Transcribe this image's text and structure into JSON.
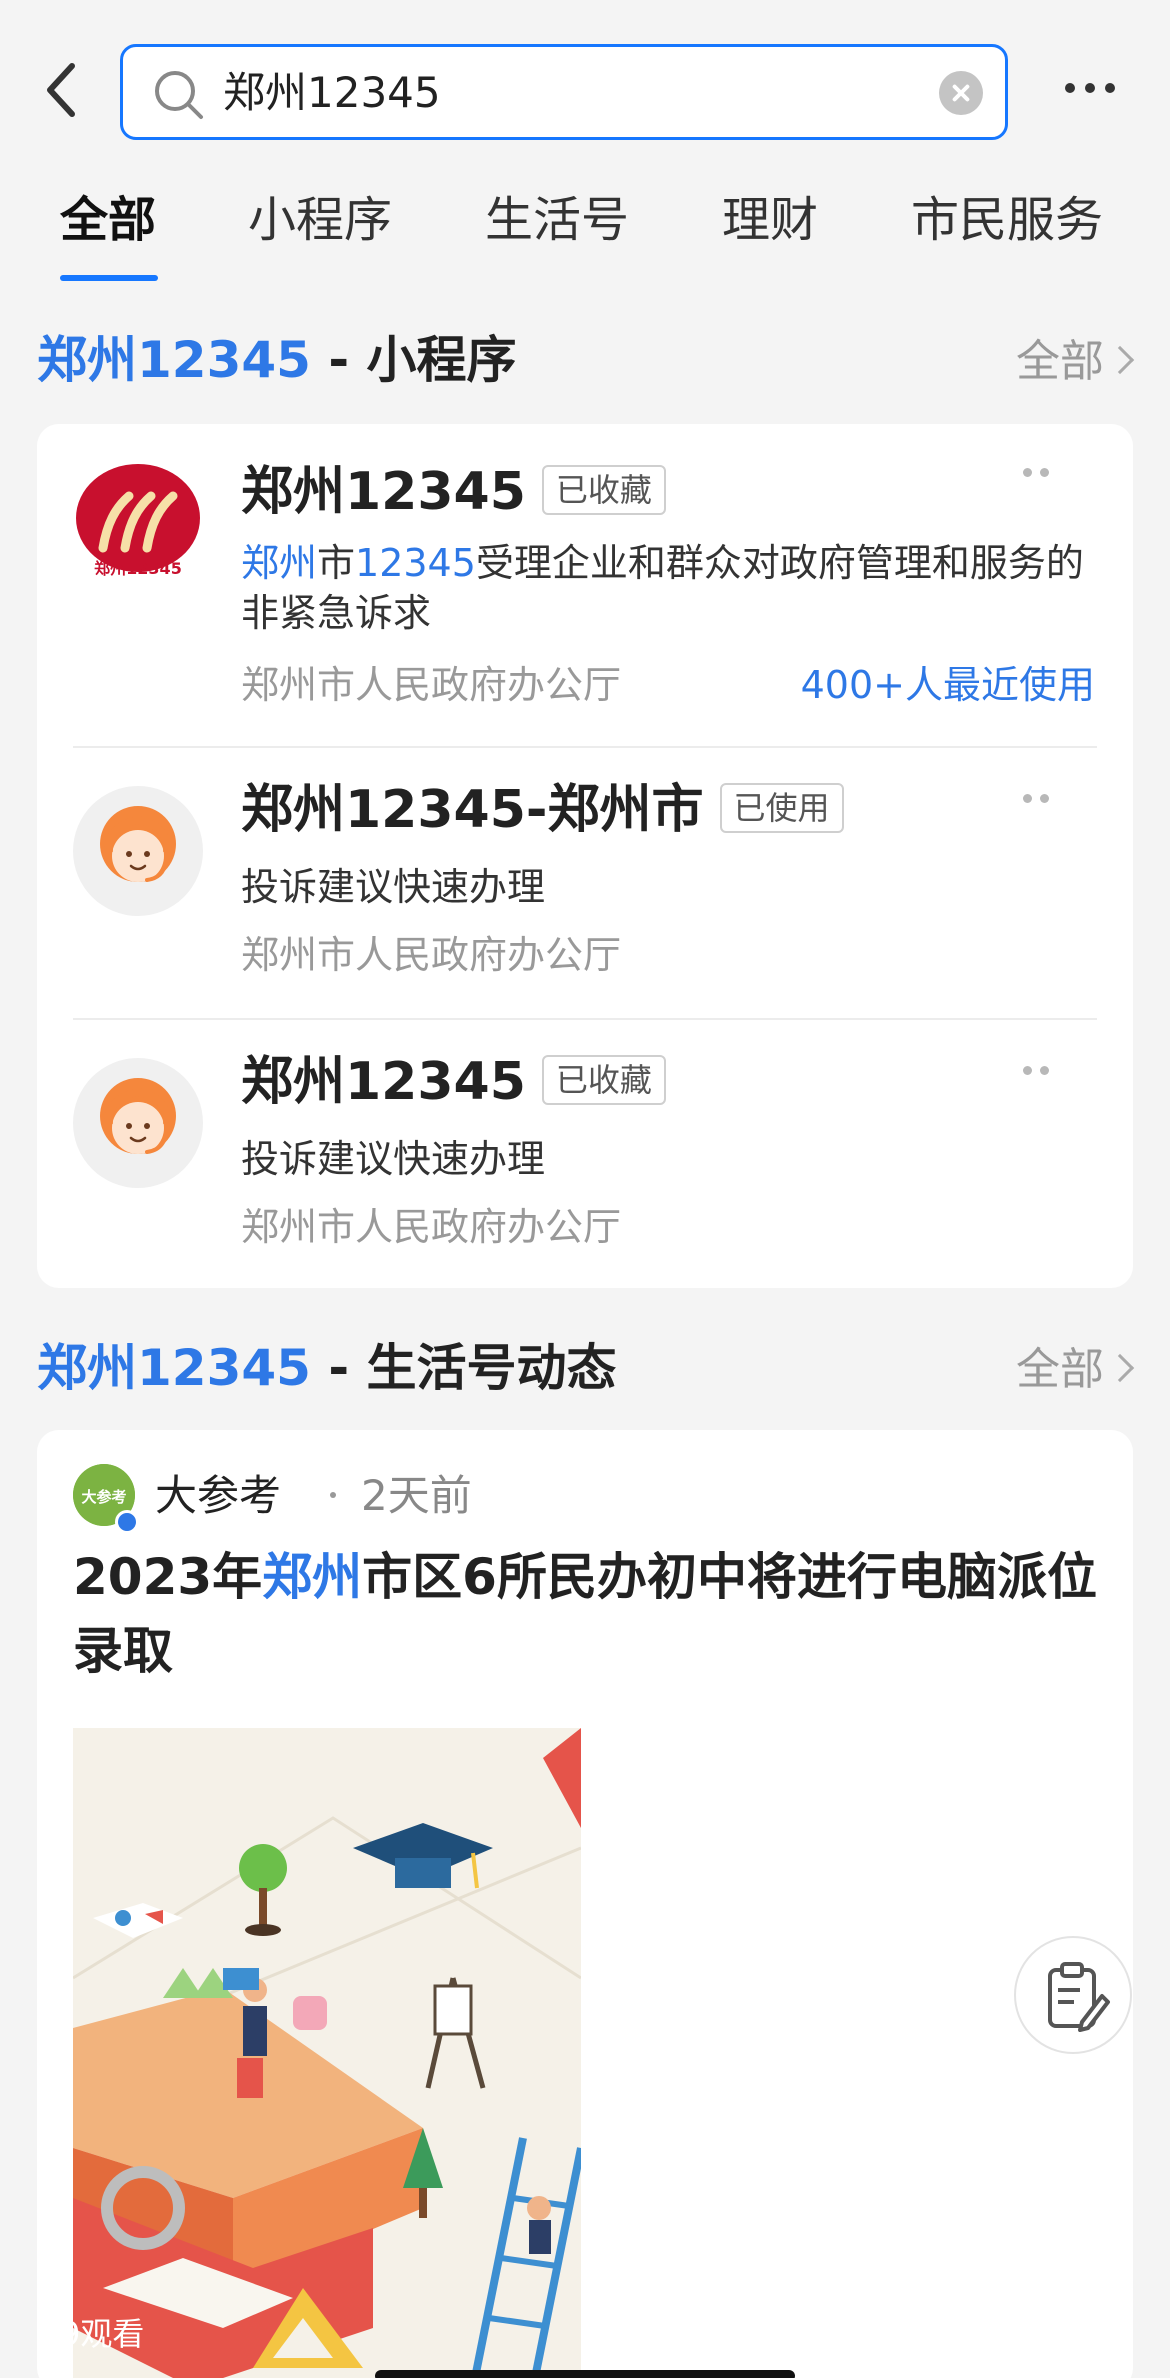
{
  "search": {
    "query": "郑州12345"
  },
  "tabs": [
    {
      "label": "全部",
      "active": true
    },
    {
      "label": "小程序",
      "active": false
    },
    {
      "label": "生活号",
      "active": false
    },
    {
      "label": "理财",
      "active": false
    },
    {
      "label": "市民服务",
      "active": false
    }
  ],
  "mini_section": {
    "keyword": "郑州12345",
    "suffix": " - 小程序",
    "more_label": "全部"
  },
  "mini_apps": [
    {
      "name": "郑州12345",
      "tag": "已收藏",
      "desc_kw1": "郑州",
      "desc_mid": "市",
      "desc_kw2": "12345",
      "desc_rest": "受理企业和群众对政府管理和服务的非紧急诉求",
      "org": "郑州市人民政府办公厅",
      "usage": "400+人最近使用",
      "icon": "zhengzhou-12345-logo",
      "logo_text": "郑州12345"
    },
    {
      "name": "郑州12345-郑州市",
      "tag": "已使用",
      "desc": "投诉建议快速办理",
      "org": "郑州市人民政府办公厅",
      "icon": "service-agent-icon"
    },
    {
      "name": "郑州12345",
      "tag": "已收藏",
      "desc": "投诉建议快速办理",
      "org": "郑州市人民政府办公厅",
      "icon": "service-agent-icon"
    }
  ],
  "life_section": {
    "keyword": "郑州12345",
    "suffix": " - 生活号动态",
    "more_label": "全部"
  },
  "feed": {
    "author": "大参考",
    "avatar_text": "大参考",
    "time": "2天前",
    "title_pre": "2023年",
    "title_kw": "郑州",
    "title_rest": "市区6所民办初中将进行电脑派位录取",
    "views": "9观看"
  },
  "colors": {
    "accent": "#1677ff",
    "keyword": "#2e78e6",
    "logo_red": "#c8102e",
    "agent_orange": "#f5873c"
  }
}
